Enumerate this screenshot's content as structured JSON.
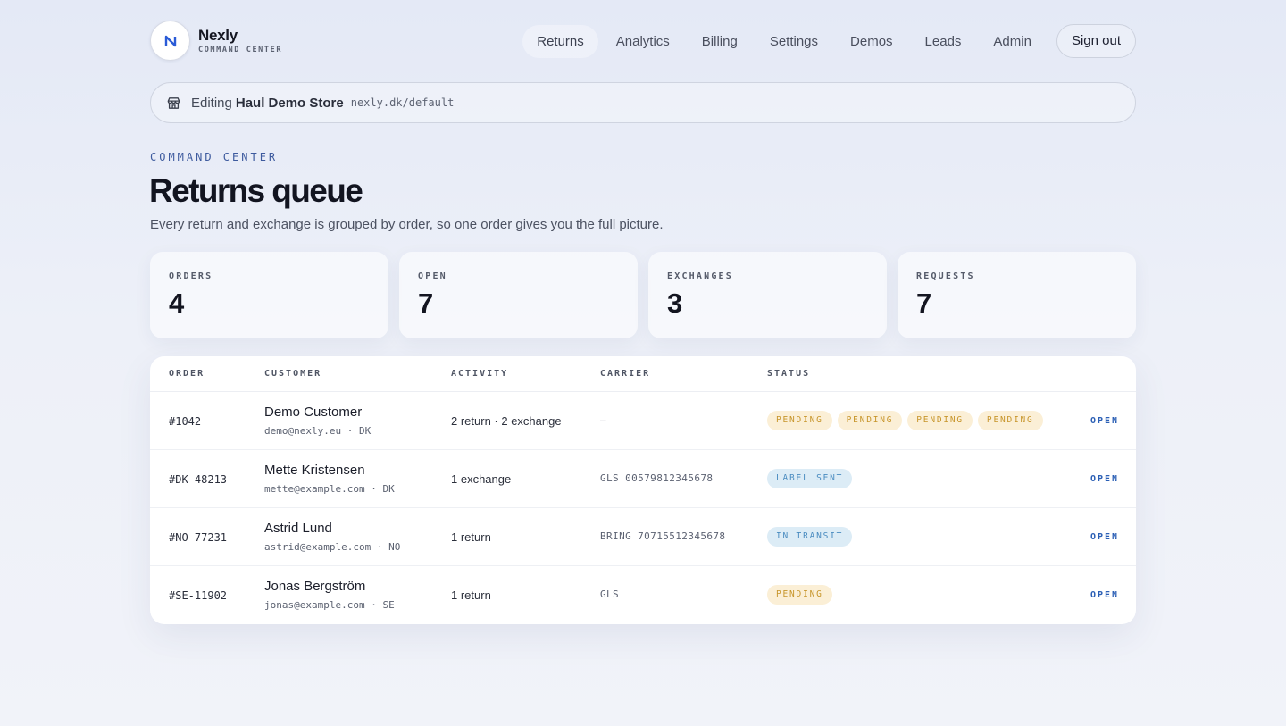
{
  "brand": {
    "name": "Nexly",
    "subtitle": "COMMAND CENTER"
  },
  "nav": {
    "items": [
      "Returns",
      "Analytics",
      "Billing",
      "Settings",
      "Demos",
      "Leads",
      "Admin"
    ],
    "active": "Returns",
    "sign_out": "Sign out"
  },
  "editing": {
    "label": "Editing",
    "store": "Haul Demo Store",
    "url": "nexly.dk/default"
  },
  "page": {
    "eyebrow": "COMMAND CENTER",
    "title": "Returns queue",
    "subtitle": "Every return and exchange is grouped by order, so one order gives you the full picture."
  },
  "stats": [
    {
      "label": "ORDERS",
      "value": "4"
    },
    {
      "label": "OPEN",
      "value": "7"
    },
    {
      "label": "EXCHANGES",
      "value": "3"
    },
    {
      "label": "REQUESTS",
      "value": "7"
    }
  ],
  "table": {
    "columns": [
      "ORDER",
      "CUSTOMER",
      "ACTIVITY",
      "CARRIER",
      "STATUS"
    ],
    "open_label": "OPEN",
    "rows": [
      {
        "order": "#1042",
        "name": "Demo Customer",
        "email": "demo@nexly.eu · DK",
        "activity": "2 return · 2 exchange",
        "carrier": "—",
        "statuses": [
          "PENDING",
          "PENDING",
          "PENDING",
          "PENDING"
        ]
      },
      {
        "order": "#DK-48213",
        "name": "Mette Kristensen",
        "email": "mette@example.com · DK",
        "activity": "1 exchange",
        "carrier": "GLS 00579812345678",
        "statuses": [
          "LABEL SENT"
        ]
      },
      {
        "order": "#NO-77231",
        "name": "Astrid Lund",
        "email": "astrid@example.com · NO",
        "activity": "1 return",
        "carrier": "BRING 70715512345678",
        "statuses": [
          "IN TRANSIT"
        ]
      },
      {
        "order": "#SE-11902",
        "name": "Jonas Bergström",
        "email": "jonas@example.com · SE",
        "activity": "1 return",
        "carrier": "GLS",
        "statuses": [
          "PENDING"
        ]
      }
    ]
  },
  "colors": {
    "accent": "#2b5fb5",
    "pending_bg": "#fbefd6",
    "pending_fg": "#c7952a",
    "info_bg": "#dcecf6",
    "info_fg": "#4a8cc0"
  }
}
